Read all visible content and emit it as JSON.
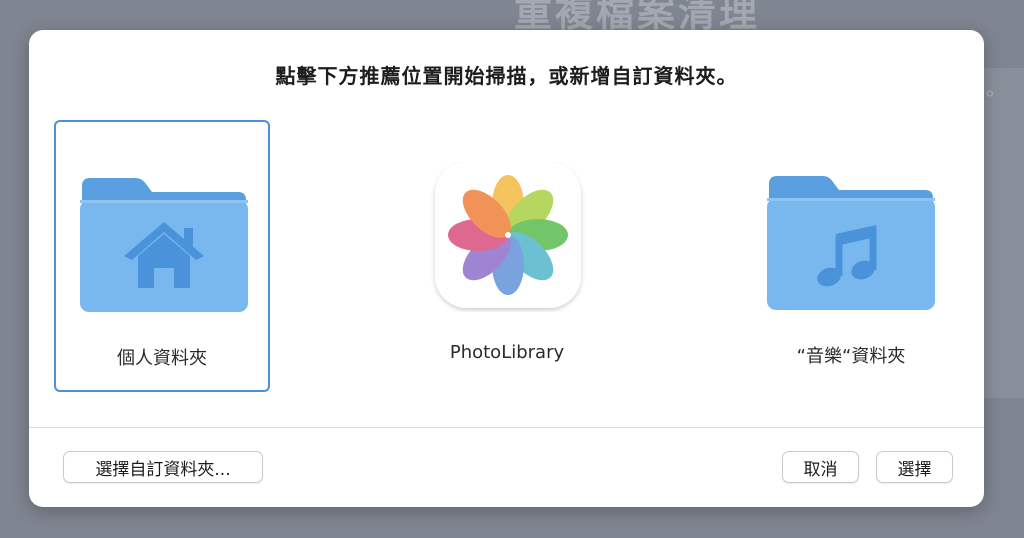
{
  "background": {
    "title": "重複檔案清理",
    "side_text": "。"
  },
  "dialog": {
    "prompt": "點擊下方推薦位置開始掃描，或新增自訂資料夾。",
    "locations": [
      {
        "label": "個人資料夾",
        "icon": "home-folder-icon",
        "selected": true
      },
      {
        "label": "PhotoLibrary",
        "icon": "photos-app-icon",
        "selected": false
      },
      {
        "label": "“音樂“資料夾",
        "icon": "music-folder-icon",
        "selected": false
      }
    ],
    "buttons": {
      "choose_custom": "選擇自訂資料夾...",
      "cancel": "取消",
      "choose": "選擇"
    }
  },
  "colors": {
    "folder_body": "#79b8ef",
    "folder_tab": "#5a9fe0",
    "folder_glyph": "#4a92d9",
    "selection": "#4b8fe0"
  }
}
